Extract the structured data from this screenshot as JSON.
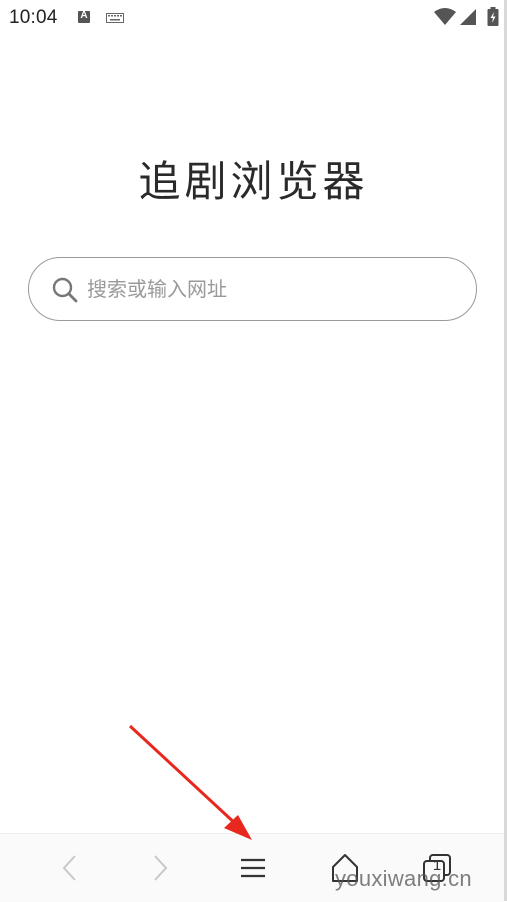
{
  "status_bar": {
    "time": "10:04",
    "notification_icons": [
      "a-icon",
      "keyboard-icon"
    ],
    "system_icons": [
      "wifi-icon",
      "signal-icon",
      "battery-icon"
    ]
  },
  "app": {
    "title": "追剧浏览器"
  },
  "search": {
    "placeholder": "搜索或输入网址",
    "icon": "search-icon"
  },
  "toolbar": {
    "items": [
      "back-icon",
      "forward-icon",
      "menu-icon",
      "home-icon",
      "tabs-icon"
    ],
    "tab_count": "1"
  },
  "annotation": {
    "arrow_color": "#e8281e",
    "points_to": "menu-button"
  },
  "watermark": {
    "text": "youxiwang.cn"
  },
  "colors": {
    "background": "#ffffff",
    "text": "#222222",
    "placeholder": "#9a9a9a",
    "icon_disabled": "#c8c8c8"
  }
}
